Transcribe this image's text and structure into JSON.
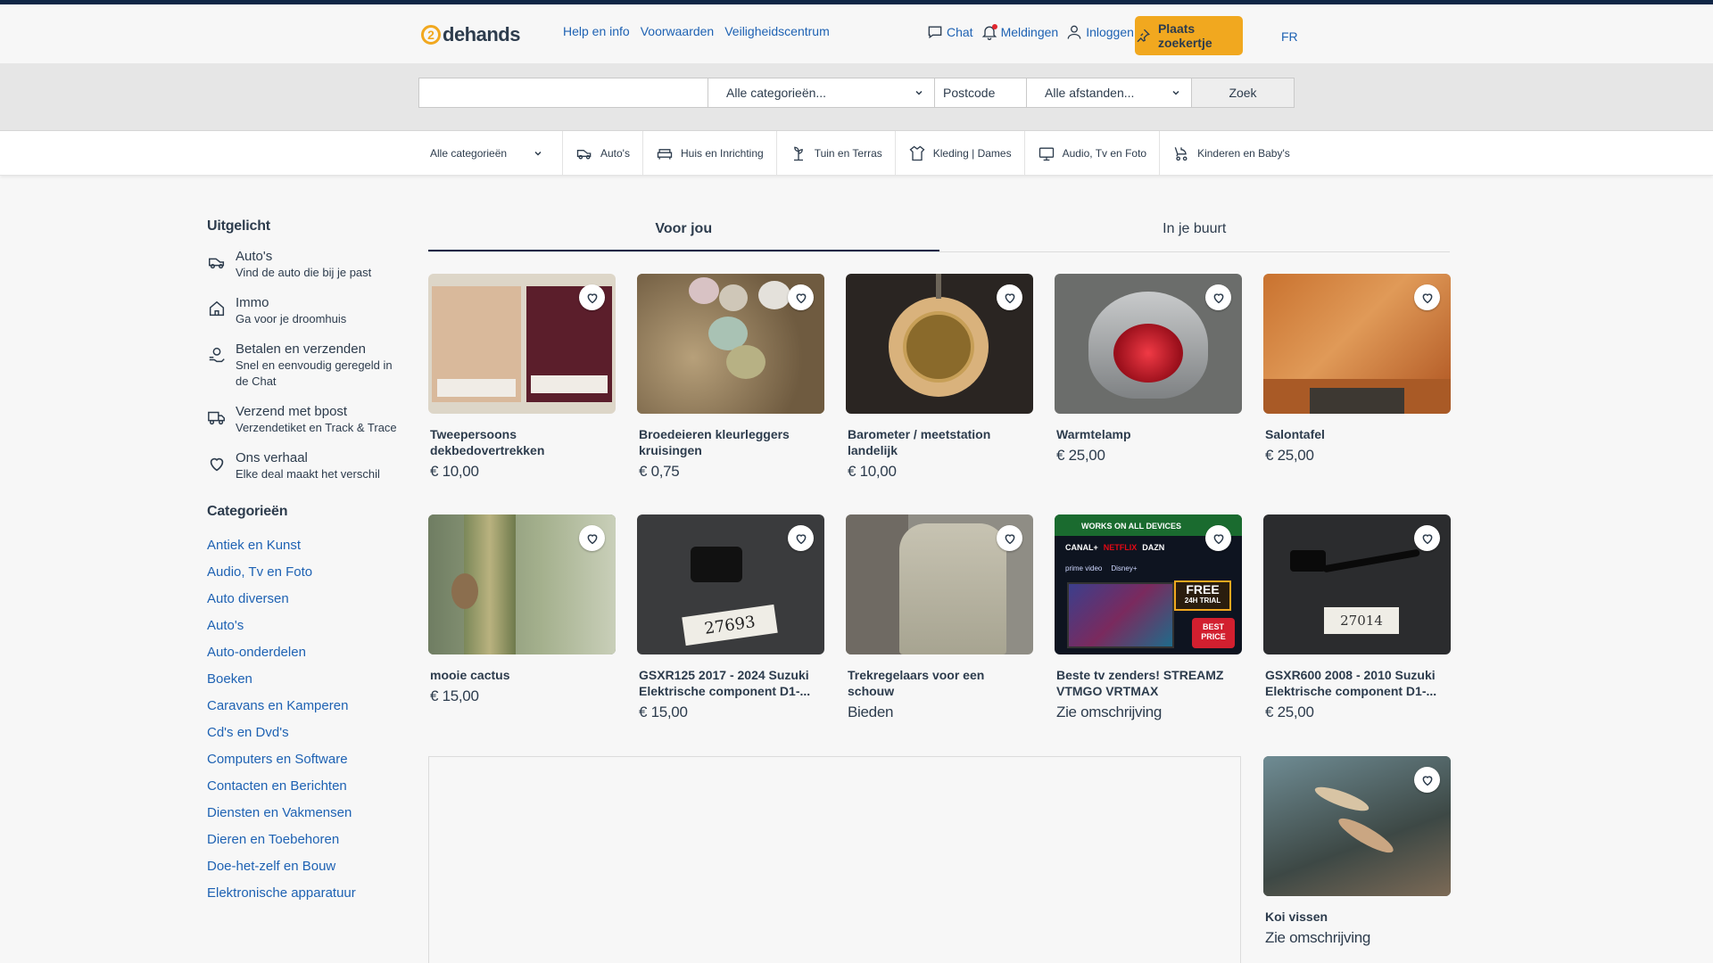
{
  "header": {
    "logo_mark": "2",
    "logo_text": "dehands",
    "links": [
      "Help en info",
      "Voorwaarden",
      "Veiligheidscentrum"
    ],
    "chat": "Chat",
    "notifications": "Meldingen",
    "login": "Inloggen",
    "place_ad": "Plaats zoekertje",
    "language": "FR"
  },
  "search": {
    "query": "",
    "category": "Alle categorieën...",
    "postcode_placeholder": "Postcode",
    "distance": "Alle afstanden...",
    "submit": "Zoek"
  },
  "category_nav": {
    "all": "Alle categorieën",
    "items": [
      "Auto's",
      "Huis en Inrichting",
      "Tuin en Terras",
      "Kleding | Dames",
      "Audio, Tv en Foto",
      "Kinderen en Baby's"
    ]
  },
  "sidebar": {
    "featured_heading": "Uitgelicht",
    "featured": [
      {
        "title": "Auto's",
        "subtitle": "Vind de auto die bij je past",
        "icon": "car-icon"
      },
      {
        "title": "Immo",
        "subtitle": "Ga voor je droomhuis",
        "icon": "house-icon"
      },
      {
        "title": "Betalen en verzenden",
        "subtitle": "Snel en eenvoudig geregeld in de Chat",
        "icon": "payment-icon"
      },
      {
        "title": "Verzend met bpost",
        "subtitle": "Verzendetiket en Track & Trace",
        "icon": "truck-icon"
      },
      {
        "title": "Ons verhaal",
        "subtitle": "Elke deal maakt het verschil",
        "icon": "heart-icon"
      }
    ],
    "categories_heading": "Categorieën",
    "categories": [
      "Antiek en Kunst",
      "Audio, Tv en Foto",
      "Auto diversen",
      "Auto's",
      "Auto-onderdelen",
      "Boeken",
      "Caravans en Kamperen",
      "Cd's en Dvd's",
      "Computers en Software",
      "Contacten en Berichten",
      "Diensten en Vakmensen",
      "Dieren en Toebehoren",
      "Doe-het-zelf en Bouw",
      "Elektronische apparatuur"
    ]
  },
  "tabs": [
    "Voor jou",
    "In je buurt"
  ],
  "listings": [
    {
      "title": "Tweepersoons dekbedovertrekken",
      "price": "€ 10,00"
    },
    {
      "title": "Broedeieren kleurleggers kruisingen",
      "price": "€ 0,75"
    },
    {
      "title": "Barometer / meetstation landelijk",
      "price": "€ 10,00"
    },
    {
      "title": "Warmtelamp",
      "price": "€ 25,00"
    },
    {
      "title": "Salontafel",
      "price": "€ 25,00"
    },
    {
      "title": "mooie cactus",
      "price": "€ 15,00"
    },
    {
      "title": "GSXR125 2017 - 2024 Suzuki Elektrische component D1-...",
      "price": "€ 15,00",
      "tag": "27693"
    },
    {
      "title": "Trekregelaars voor een schouw",
      "price": "Bieden"
    },
    {
      "title": "Beste tv zenders! STREAMZ VTMGO VRTMAX",
      "price": "Zie omschrijving",
      "banner": {
        "works": "WORKS ON ALL DEVICES",
        "free": "FREE",
        "trial": "24H TRIAL",
        "best": "BEST PRICE",
        "brands": [
          "CANAL+",
          "NETFLIX",
          "DAZN",
          "prime video",
          "Disney+"
        ]
      }
    },
    {
      "title": "GSXR600 2008 - 2010 Suzuki Elektrische component D1-...",
      "price": "€ 25,00",
      "tag": "27014"
    },
    {
      "title": "Koi vissen",
      "price": "Zie omschrijving"
    }
  ],
  "colors": {
    "accent": "#f1a81f",
    "link": "#1e62b3",
    "text": "#2d3c4d",
    "topline": "#102646"
  }
}
